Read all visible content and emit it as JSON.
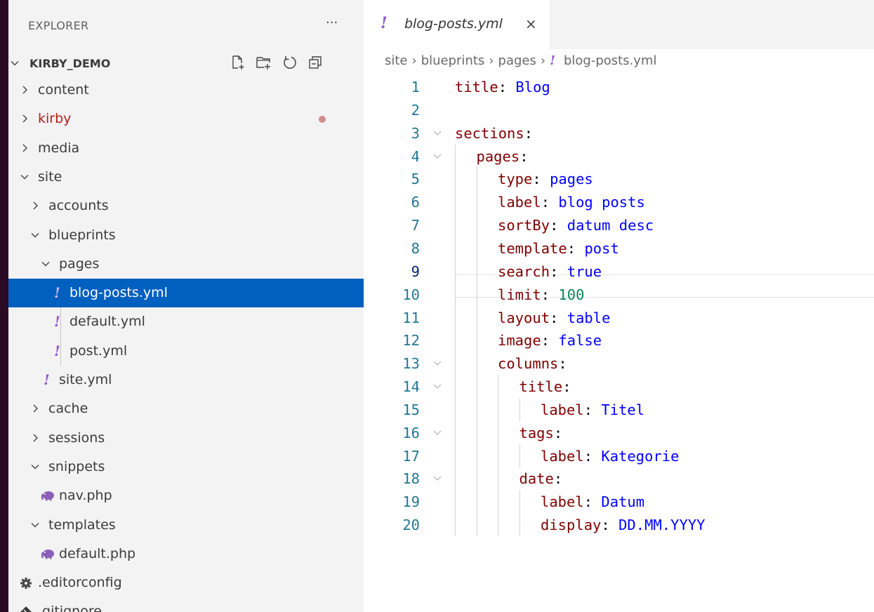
{
  "explorer": {
    "title": "EXPLORER",
    "more_label": "···",
    "workspace": "KIRBY_DEMO",
    "actions": [
      "new-file-icon",
      "new-folder-icon",
      "refresh-icon",
      "collapse-all-icon"
    ],
    "items": [
      {
        "label": "content",
        "type": "folder",
        "expanded": false
      },
      {
        "label": "kirby",
        "type": "folder",
        "expanded": false,
        "modified": true,
        "color": "#b31c1c"
      },
      {
        "label": "media",
        "type": "folder",
        "expanded": false
      },
      {
        "label": "site",
        "type": "folder",
        "expanded": true
      },
      {
        "label": "accounts",
        "type": "folder",
        "expanded": false
      },
      {
        "label": "blueprints",
        "type": "folder",
        "expanded": true
      },
      {
        "label": "pages",
        "type": "folder",
        "expanded": true
      },
      {
        "label": "blog-posts.yml",
        "type": "yaml",
        "selected": true
      },
      {
        "label": "default.yml",
        "type": "yaml"
      },
      {
        "label": "post.yml",
        "type": "yaml"
      },
      {
        "label": "site.yml",
        "type": "yaml"
      },
      {
        "label": "cache",
        "type": "folder",
        "expanded": false
      },
      {
        "label": "sessions",
        "type": "folder",
        "expanded": false
      },
      {
        "label": "snippets",
        "type": "folder",
        "expanded": true
      },
      {
        "label": "nav.php",
        "type": "php"
      },
      {
        "label": "templates",
        "type": "folder",
        "expanded": true
      },
      {
        "label": "default.php",
        "type": "php"
      },
      {
        "label": ".editorconfig",
        "type": "config"
      },
      {
        "label": ".gitignore",
        "type": "git"
      }
    ]
  },
  "editor": {
    "tab": {
      "icon": "!",
      "name": "blog-posts.yml",
      "close": "×"
    },
    "breadcrumb": [
      "site",
      "blueprints",
      "pages",
      "blog-posts.yml"
    ],
    "breadcrumb_sep": "›",
    "file_icon": "!",
    "current_line": 9,
    "lines": [
      {
        "n": "1",
        "key": "title",
        "sep": ": ",
        "val": "Blog"
      },
      {
        "n": "2"
      },
      {
        "n": "3",
        "key": "sections",
        "sep": ":",
        "fold": true
      },
      {
        "n": "4",
        "key": "pages",
        "sep": ":",
        "fold": true
      },
      {
        "n": "5",
        "key": "type",
        "sep": ": ",
        "val": "pages"
      },
      {
        "n": "6",
        "key": "label",
        "sep": ": ",
        "val": "blog posts"
      },
      {
        "n": "7",
        "key": "sortBy",
        "sep": ": ",
        "val": "datum desc"
      },
      {
        "n": "8",
        "key": "template",
        "sep": ": ",
        "val": "post"
      },
      {
        "n": "9",
        "key": "search",
        "sep": ": ",
        "val": "true"
      },
      {
        "n": "10",
        "key": "limit",
        "sep": ": ",
        "val": "100",
        "num": true
      },
      {
        "n": "11",
        "key": "layout",
        "sep": ": ",
        "val": "table"
      },
      {
        "n": "12",
        "key": "image",
        "sep": ": ",
        "val": "false"
      },
      {
        "n": "13",
        "key": "columns",
        "sep": ":",
        "fold": true
      },
      {
        "n": "14",
        "key": "title",
        "sep": ":",
        "fold": true
      },
      {
        "n": "15",
        "key": "label",
        "sep": ": ",
        "val": "Titel"
      },
      {
        "n": "16",
        "key": "tags",
        "sep": ":",
        "fold": true
      },
      {
        "n": "17",
        "key": "label",
        "sep": ": ",
        "val": "Kategorie"
      },
      {
        "n": "18",
        "key": "date",
        "sep": ":",
        "fold": true
      },
      {
        "n": "19",
        "key": "label",
        "sep": ": ",
        "val": "Datum"
      },
      {
        "n": "20",
        "key": "display",
        "sep": ": ",
        "val": "DD.MM.YYYY"
      }
    ]
  }
}
